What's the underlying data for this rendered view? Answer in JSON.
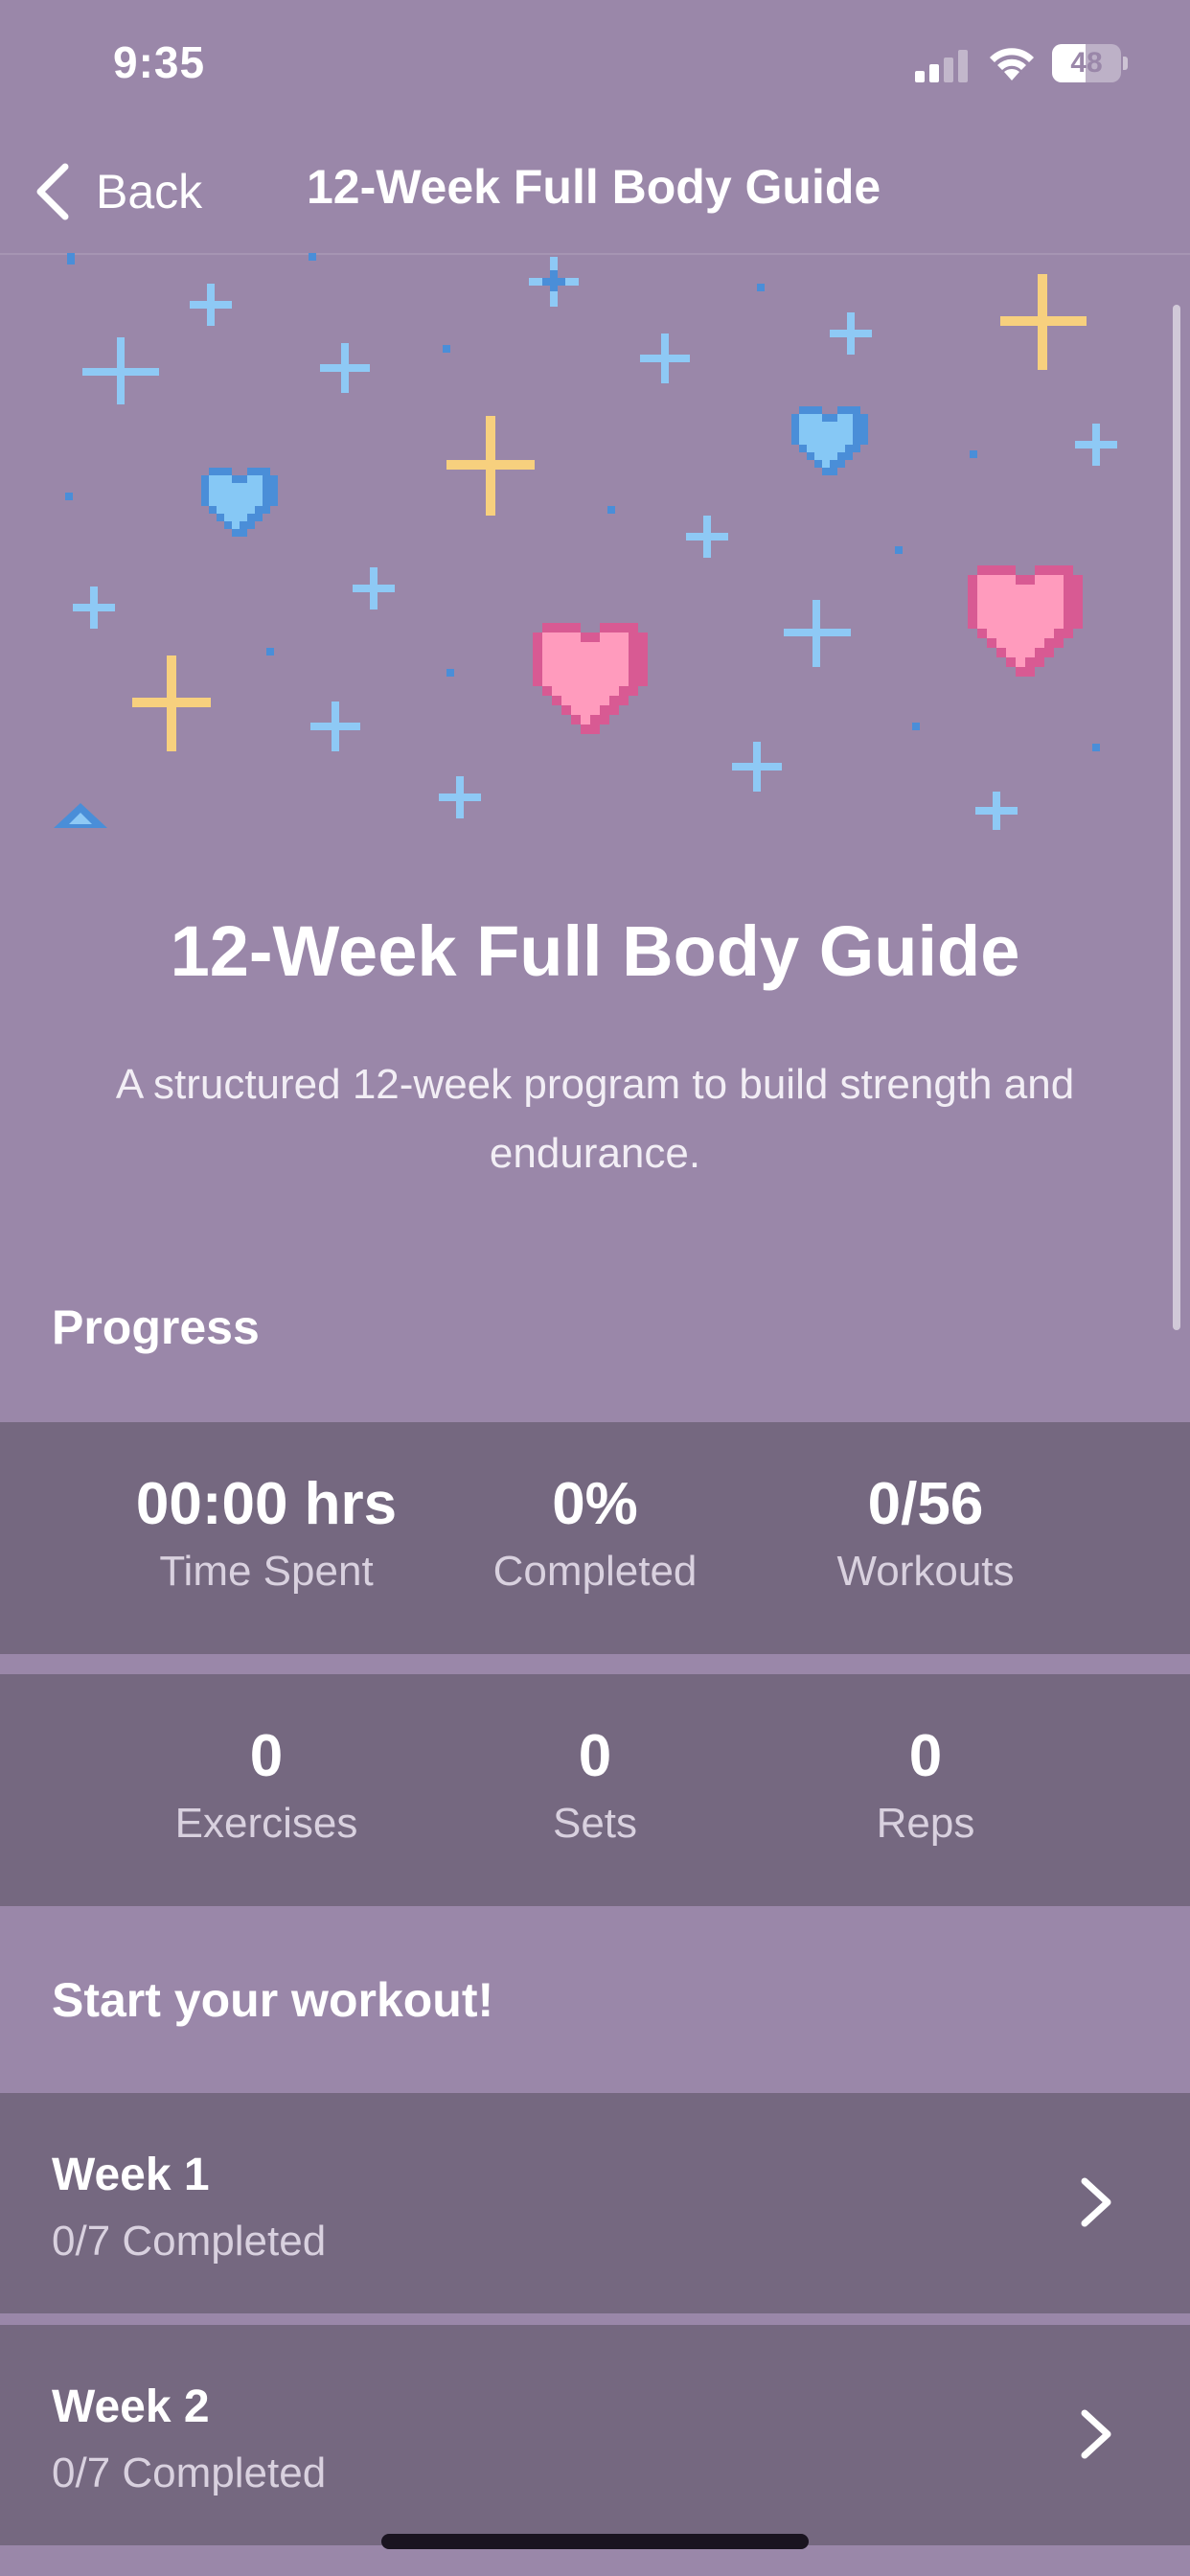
{
  "status_bar": {
    "time": "9:35",
    "battery_level": "48",
    "battery_fraction": 0.48
  },
  "nav": {
    "back_label": "Back",
    "title": "12-Week Full Body Guide"
  },
  "guide": {
    "title": "12-Week Full Body Guide",
    "description": "A structured 12-week program to build strength and endurance."
  },
  "progress": {
    "heading": "Progress",
    "stats_row1": [
      {
        "value": "00:00 hrs",
        "label": "Time Spent"
      },
      {
        "value": "0%",
        "label": "Completed"
      },
      {
        "value": "0/56",
        "label": "Workouts"
      }
    ],
    "stats_row2": [
      {
        "value": "0",
        "label": "Exercises"
      },
      {
        "value": "0",
        "label": "Sets"
      },
      {
        "value": "0",
        "label": "Reps"
      }
    ]
  },
  "workout": {
    "heading": "Start your workout!",
    "weeks": [
      {
        "title": "Week 1",
        "status": "0/7 Completed"
      },
      {
        "title": "Week 2",
        "status": "0/7 Completed"
      }
    ]
  },
  "colors": {
    "background": "#9a87a9",
    "panel": "#756880",
    "heart_pink": "#ff9bbd",
    "heart_blue": "#86c8f5",
    "sparkle_yellow": "#f7d07e",
    "sparkle_blue": "#8ec9f5"
  },
  "icons": [
    "back-chevron-icon",
    "signal-icon",
    "wifi-icon",
    "battery-icon",
    "chevron-right-icon"
  ]
}
